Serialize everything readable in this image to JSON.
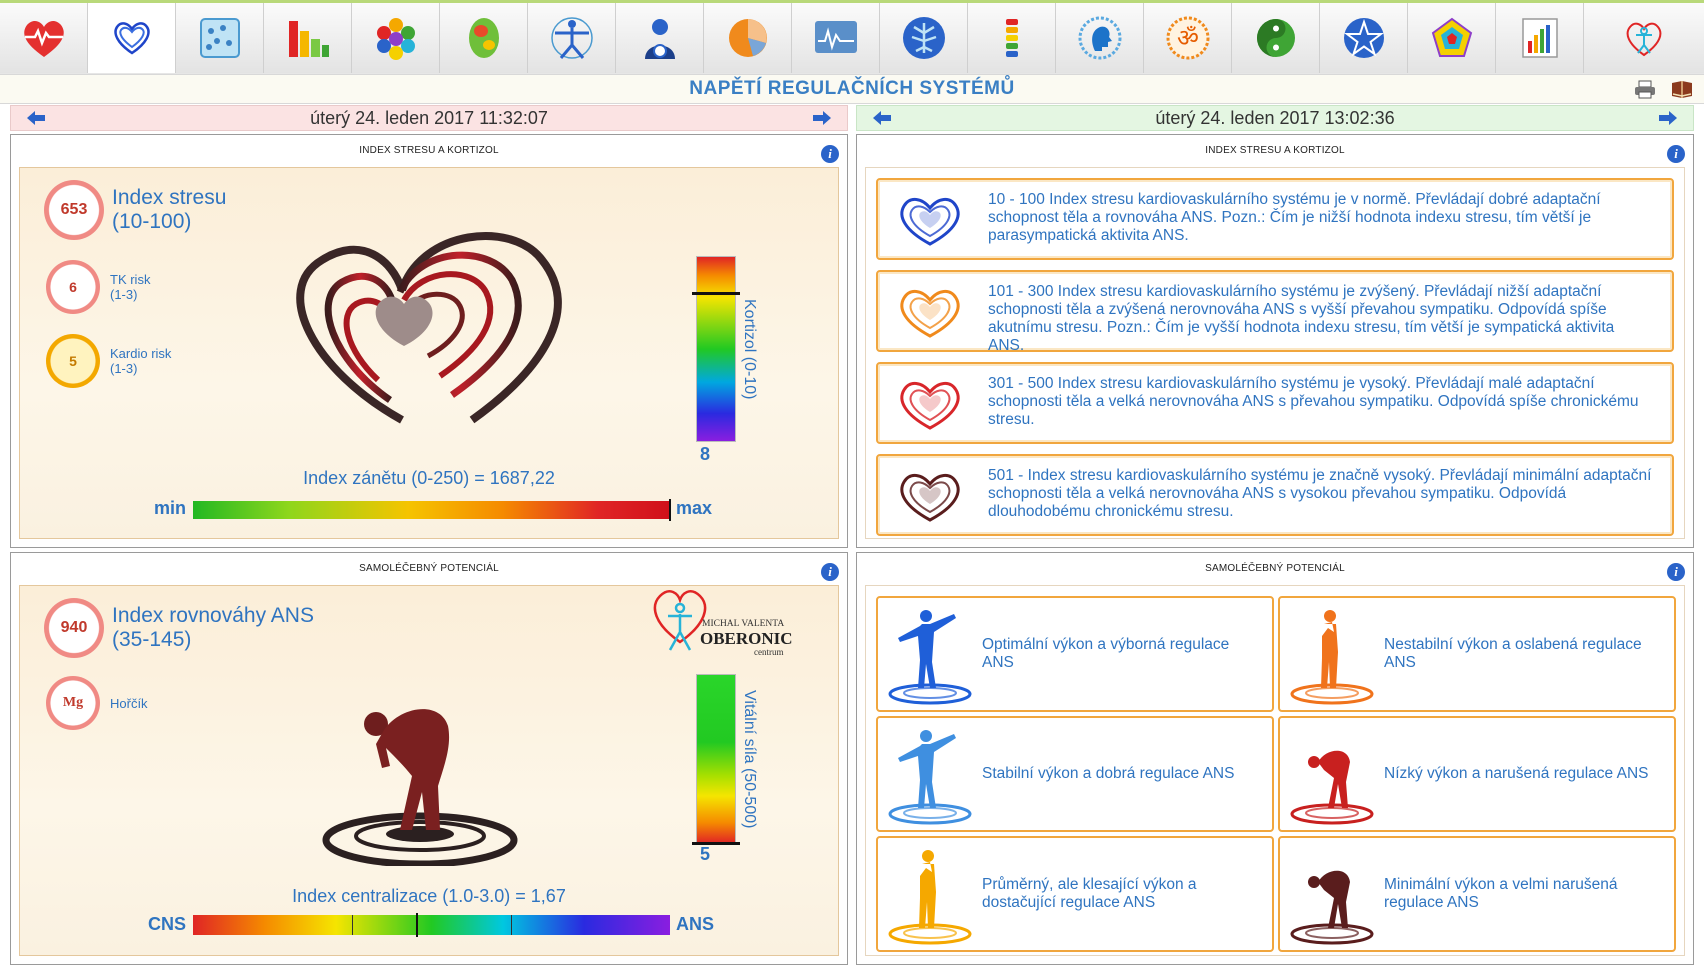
{
  "toolbar": {
    "icons": [
      "heart-pulse-icon",
      "heart-waves-icon",
      "cells-icon",
      "bar-chart-icon",
      "hexagon-cluster-icon",
      "brain-scan-icon",
      "vitruvian-man-icon",
      "person-icon",
      "pie-chart-icon",
      "ecg-monitor-icon",
      "lungs-tree-icon",
      "spine-icon",
      "head-profile-icon",
      "om-symbol-icon",
      "yin-yang-icon",
      "pentagram-icon",
      "radar-chart-icon",
      "report-chart-icon",
      "logo-small-icon"
    ]
  },
  "title": "NAPĚTÍ REGULAČNÍCH SYSTÉMŮ",
  "dates": {
    "left": "úterý 24. leden 2017 11:32:07",
    "right": "úterý 24. leden 2017 13:02:36"
  },
  "stress_panel": {
    "header": "INDEX STRESU A KORTIZOL",
    "stress_value": "653",
    "stress_label": "Index stresu",
    "stress_range": "(10-100)",
    "tk_value": "6",
    "tk_label": "TK risk",
    "tk_range": "(1-3)",
    "kardio_value": "5",
    "kardio_label": "Kardio risk",
    "kardio_range": "(1-3)",
    "kortizol_label": "Kortizol (0-10)",
    "kortizol_value": "8",
    "kortizol_level": 0.8,
    "zanet_label": "Index zánětu (0-250) = 1687,22",
    "scale_min": "min",
    "scale_max": "max"
  },
  "stress_legend": {
    "header": "INDEX STRESU A KORTIZOL",
    "items": [
      {
        "text": "10 - 100 Index stresu kardiovaskulárního systému je v normě. Převládají dobré adaptační schopnost těla a rovnováha ANS. Pozn.: Čím je nižší hodnota indexu stresu, tím větší je parasympatická aktivita ANS.",
        "color": "#1f45c9"
      },
      {
        "text": "101 - 300 Index stresu kardiovaskulárního systému je zvýšený. Převládají nižší adaptační schopnosti těla a zvýšená nerovnováha ANS s vyšší převahou sympatiku. Odpovídá spíše akutnímu stresu. Pozn.: Čím je vyšší hodnota indexu stresu, tím větší je sympatická aktivita ANS.",
        "color": "#f08a1c"
      },
      {
        "text": "301 - 500 Index stresu kardiovaskulárního systému je vysoký. Převládají malé adaptační schopnosti těla a velká nerovnováha ANS s převahou sympatiku. Odpovídá spíše chronickému stresu.",
        "color": "#d8262a"
      },
      {
        "text": "501 - Index stresu kardiovaskulárního systému je značně vysoký. Převládají minimální adaptační schopnosti těla a velká nerovnováha ANS s vysokou převahou sympatiku. Odpovídá dlouhodobému chronickému stresu.",
        "color": "#5a1d1d"
      }
    ]
  },
  "potential_panel": {
    "header": "SAMOLÉČEBNÝ POTENCIÁL",
    "ans_value": "940",
    "ans_label": "Index rovnováhy ANS",
    "ans_range": "(35-145)",
    "mg_value": "Mg",
    "mg_label": "Hořčík",
    "logo_name": "MICHAL VALENTA",
    "logo_brand": "OBERONIC",
    "logo_sub": "centrum",
    "vital_label": "Vitální síla (50-500)",
    "vital_value": "5",
    "central_label": "Index centralizace (1.0-3.0) = 1,67",
    "scale_left": "CNS",
    "scale_right": "ANS"
  },
  "potential_legend": {
    "header": "SAMOLÉČEBNÝ POTENCIÁL",
    "items": [
      {
        "text": "Optimální výkon a výborná regulace ANS",
        "color": "#1f5fd8",
        "pose": "open"
      },
      {
        "text": "Nestabilní výkon a oslabená regulace ANS",
        "color": "#f0731c",
        "pose": "think"
      },
      {
        "text": "Stabilní výkon a dobrá regulace ANS",
        "color": "#3f8fe0",
        "pose": "open"
      },
      {
        "text": "Nízký výkon a narušená regulace ANS",
        "color": "#c8201f",
        "pose": "bent"
      },
      {
        "text": "Průměrný, ale klesající výkon a dostačující regulace ANS",
        "color": "#f5a800",
        "pose": "think"
      },
      {
        "text": "Minimální výkon a velmi narušená regulace ANS",
        "color": "#5a1d1d",
        "pose": "bent"
      }
    ]
  }
}
